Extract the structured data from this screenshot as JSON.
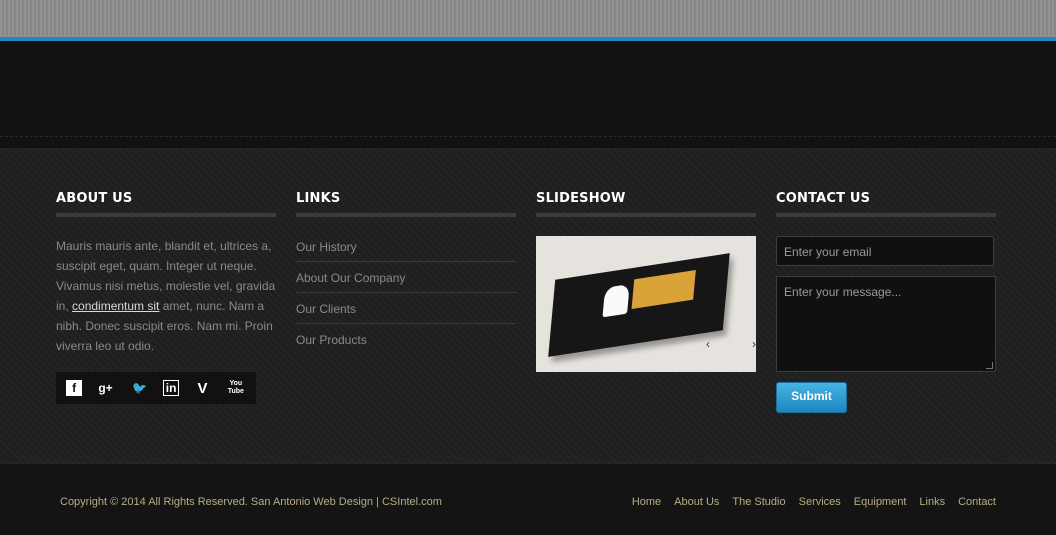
{
  "about": {
    "title": "ABOUT US",
    "text_before": "Mauris mauris ante, blandit et, ultrices a, suscipit eget, quam. Integer ut neque. Vivamus nisi metus, molestie vel, gravida in, ",
    "link": "condimentum sit",
    "text_after": " amet, nunc. Nam a nibh. Donec suscipit eros. Nam mi. Proin viverra leo ut odio."
  },
  "social": {
    "facebook": "f",
    "google": "g+",
    "twitter": "🐦",
    "linkedin": "in",
    "vimeo": "V",
    "youtube": "You Tube"
  },
  "links": {
    "title": "LINKS",
    "items": [
      "Our History",
      "About Our Company",
      "Our Clients",
      "Our Products"
    ]
  },
  "slideshow": {
    "title": "SLIDESHOW",
    "prev": "‹",
    "next": "›"
  },
  "contact": {
    "title": "CONTACT US",
    "email_placeholder": "Enter your email",
    "message_placeholder": "Enter your message...",
    "submit_label": "Submit"
  },
  "footer": {
    "copyright": "Copyright © 2014 All Rights Reserved.  San Antonio Web Design | CSIntel.com",
    "nav": [
      "Home",
      "About Us",
      "The Studio",
      "Services",
      "Equipment",
      "Links",
      "Contact"
    ]
  }
}
